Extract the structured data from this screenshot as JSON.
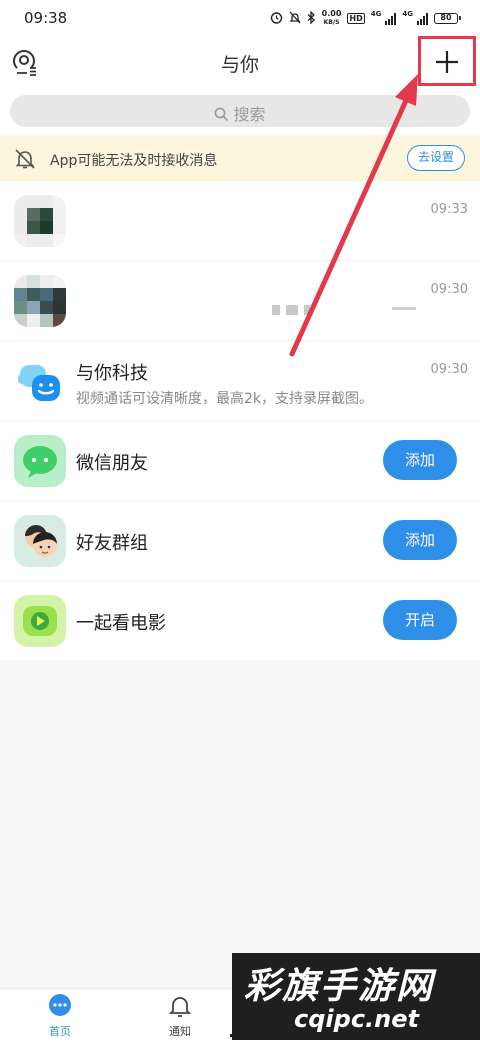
{
  "status_bar": {
    "time": "09:38",
    "net_speed_value": "0.00",
    "net_speed_unit": "KB/S",
    "hd_badge": "HD",
    "net_type_1": "4G",
    "net_type_2": "4G",
    "battery": "80"
  },
  "header": {
    "title": "与你"
  },
  "search": {
    "placeholder": "搜索"
  },
  "notice": {
    "text": "App可能无法及时接收消息",
    "button": "去设置"
  },
  "list": [
    {
      "name": "",
      "subtitle": "",
      "time": "09:33"
    },
    {
      "name": "",
      "subtitle": "",
      "time": "09:30"
    },
    {
      "name": "与你科技",
      "subtitle": "视频通话可设清晰度，最高2k，支持录屏截图。",
      "time": "09:30"
    },
    {
      "name": "微信朋友",
      "action": "添加"
    },
    {
      "name": "好友群组",
      "action": "添加"
    },
    {
      "name": "一起看电影",
      "action": "开启"
    }
  ],
  "bottom_nav": {
    "home": "首页",
    "notify": "通知"
  },
  "watermark": {
    "chinese": "彩旗手游网",
    "url": "cqipc.net"
  },
  "colors": {
    "accent": "#2f8fe6",
    "annotation": "#e23a4a",
    "notice_bg": "#fdf6dd",
    "wechat_green": "#3fcf6b",
    "movie_green": "#9be04c"
  }
}
